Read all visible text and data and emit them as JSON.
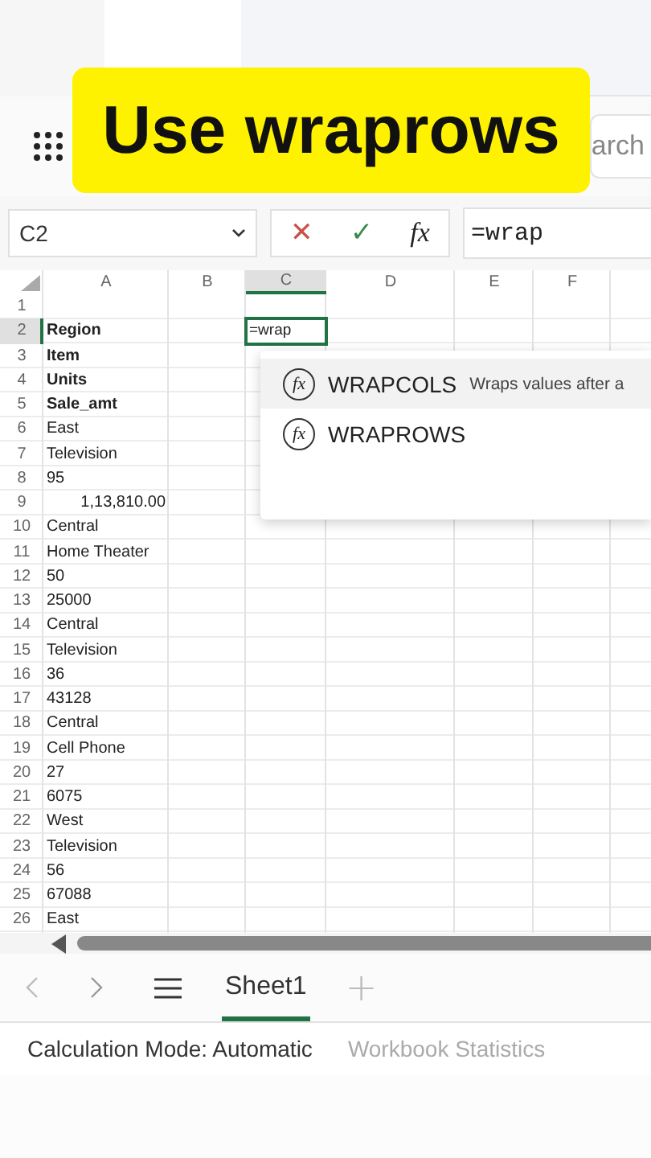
{
  "caption": "Use wraprows",
  "search": {
    "placeholder": "arch"
  },
  "name_box": {
    "value": "C2"
  },
  "formula_bar": {
    "cancel": "✕",
    "enter": "✓",
    "function": "fx",
    "value": "=wrap"
  },
  "columns": [
    {
      "label": "A",
      "selected": false
    },
    {
      "label": "B",
      "selected": false
    },
    {
      "label": "C",
      "selected": true
    },
    {
      "label": "D",
      "selected": false
    },
    {
      "label": "E",
      "selected": false
    },
    {
      "label": "F",
      "selected": false
    }
  ],
  "rows": [
    {
      "number": "1",
      "selected": false
    },
    {
      "number": "2",
      "selected": true,
      "a": "Region",
      "bold": true,
      "editing": "=wrap"
    },
    {
      "number": "3",
      "selected": false,
      "a": "Item",
      "bold": true
    },
    {
      "number": "4",
      "selected": false,
      "a": "Units",
      "bold": true
    },
    {
      "number": "5",
      "selected": false,
      "a": "Sale_amt",
      "bold": true
    },
    {
      "number": "6",
      "selected": false,
      "a": "East",
      "bold": false
    },
    {
      "number": "7",
      "selected": false,
      "a": "Television",
      "bold": false
    },
    {
      "number": "8",
      "selected": false,
      "a": "95",
      "bold": false
    },
    {
      "number": "9",
      "selected": false,
      "a": "1,13,810.00",
      "bold": false,
      "kind": "number"
    },
    {
      "number": "10",
      "selected": false,
      "a": "Central",
      "bold": false
    },
    {
      "number": "11",
      "selected": false,
      "a": "Home Theater",
      "bold": false
    },
    {
      "number": "12",
      "selected": false,
      "a": "50",
      "bold": false
    },
    {
      "number": "13",
      "selected": false,
      "a": "25000",
      "bold": false
    },
    {
      "number": "14",
      "selected": false,
      "a": "Central",
      "bold": false
    },
    {
      "number": "15",
      "selected": false,
      "a": "Television",
      "bold": false
    },
    {
      "number": "16",
      "selected": false,
      "a": "36",
      "bold": false
    },
    {
      "number": "17",
      "selected": false,
      "a": "43128",
      "bold": false
    },
    {
      "number": "18",
      "selected": false,
      "a": "Central",
      "bold": false
    },
    {
      "number": "19",
      "selected": false,
      "a": "Cell Phone",
      "bold": false
    },
    {
      "number": "20",
      "selected": false,
      "a": "27",
      "bold": false
    },
    {
      "number": "21",
      "selected": false,
      "a": "6075",
      "bold": false
    },
    {
      "number": "22",
      "selected": false,
      "a": "West",
      "bold": false
    },
    {
      "number": "23",
      "selected": false,
      "a": "Television",
      "bold": false
    },
    {
      "number": "24",
      "selected": false,
      "a": "56",
      "bold": false
    },
    {
      "number": "25",
      "selected": false,
      "a": "67088",
      "bold": false
    },
    {
      "number": "26",
      "selected": false,
      "a": "East",
      "bold": false
    }
  ],
  "suggestions": [
    {
      "icon": "fx",
      "name": "WRAPCOLS",
      "description": "Wraps values after a",
      "selected": true
    },
    {
      "icon": "fx",
      "name": "WRAPROWS",
      "selected": false
    }
  ],
  "sheet_tabs": [
    {
      "label": "Sheet1",
      "selected": true
    }
  ],
  "tab_bar": {
    "add": "+"
  },
  "status_bar": {
    "calculation": "Calculation Mode: Automatic",
    "statistics": "Workbook Statistics"
  }
}
